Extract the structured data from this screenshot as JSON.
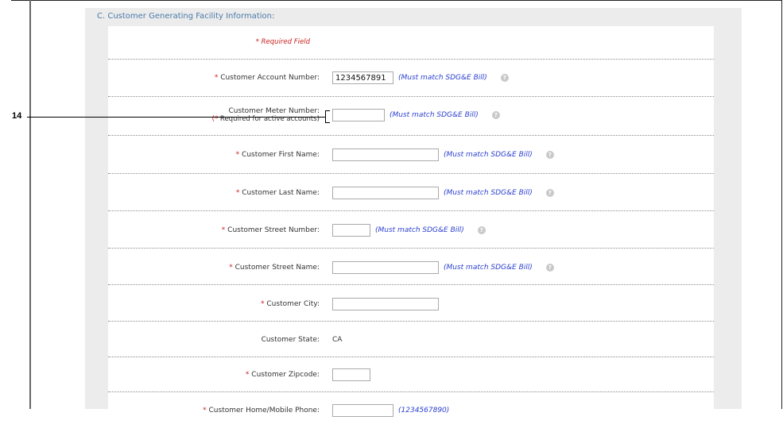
{
  "section": {
    "title": "C. Customer Generating Facility Information:"
  },
  "required_note": "* Required Field",
  "callout": {
    "label": "14"
  },
  "help_icon_glyph": "?",
  "fields": {
    "account_number": {
      "star": "*",
      "label": "Customer Account Number:",
      "value": "1234567891",
      "hint": "(Must match SDG&E Bill)"
    },
    "meter_number": {
      "label": "Customer Meter Number:",
      "sub_open": "(",
      "sub_star": "*",
      "sub_text": " Required for active accounts)",
      "value": "",
      "hint": "(Must match SDG&E Bill)"
    },
    "first_name": {
      "star": "*",
      "label": "Customer First Name:",
      "value": "",
      "hint": "(Must match SDG&E Bill)"
    },
    "last_name": {
      "star": "*",
      "label": "Customer Last Name:",
      "value": "",
      "hint": "(Must match SDG&E Bill)"
    },
    "street_number": {
      "star": "*",
      "label": "Customer Street Number:",
      "value": "",
      "hint": "(Must match SDG&E Bill)"
    },
    "street_name": {
      "star": "*",
      "label": "Customer Street Name:",
      "value": "",
      "hint": "(Must match SDG&E Bill)"
    },
    "city": {
      "star": "*",
      "label": "Customer City:",
      "value": ""
    },
    "state": {
      "label": "Customer State:",
      "value": "CA"
    },
    "zipcode": {
      "star": "*",
      "label": "Customer Zipcode:",
      "value": ""
    },
    "home_phone": {
      "star": "*",
      "label": "Customer Home/Mobile Phone:",
      "value": "",
      "hint": "(1234567890)"
    }
  }
}
